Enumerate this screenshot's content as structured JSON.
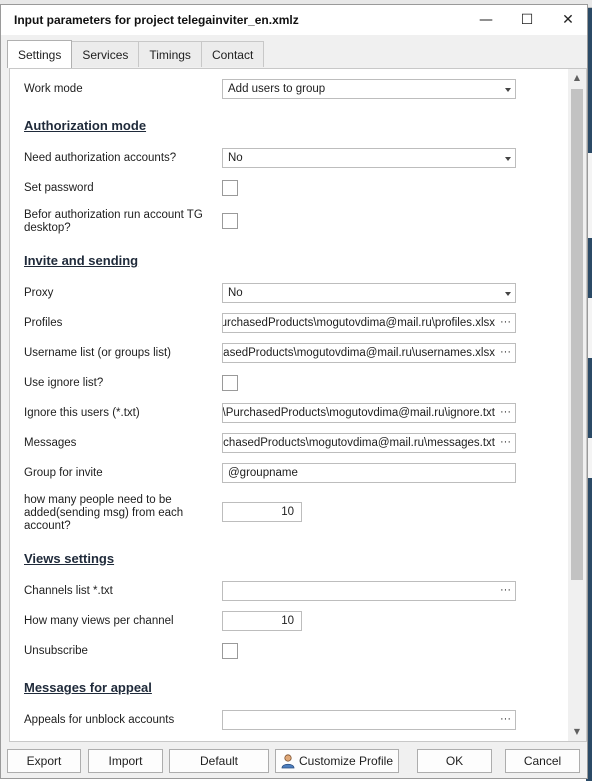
{
  "window": {
    "title": "Input parameters for project telegainviter_en.xmlz",
    "minimize_glyph": "—",
    "maximize_glyph": "☐",
    "close_glyph": "✕"
  },
  "tabs": [
    {
      "label": "Settings",
      "active": true
    },
    {
      "label": "Services",
      "active": false
    },
    {
      "label": "Timings",
      "active": false
    },
    {
      "label": "Contact",
      "active": false
    }
  ],
  "settings": {
    "work_mode": {
      "label": "Work mode",
      "value": "Add users to group"
    },
    "sections": {
      "authorization": "Authorization mode",
      "invite": "Invite and sending",
      "views": "Views settings",
      "appeal": "Messages for appeal"
    },
    "need_auth": {
      "label": "Need authorization accounts?",
      "value": "No"
    },
    "set_password": {
      "label": "Set password",
      "checked": false
    },
    "run_tg_desktop": {
      "label": "Befor authorization run account TG desktop?",
      "checked": false
    },
    "proxy": {
      "label": "Proxy",
      "value": "No"
    },
    "profiles": {
      "label": "Profiles",
      "value": "\\PurchasedProducts\\mogutovdima@mail.ru\\profiles.xlsx"
    },
    "username_list": {
      "label": "Username list (or groups list)",
      "value": "chasedProducts\\mogutovdima@mail.ru\\usernames.xlsx"
    },
    "use_ignore": {
      "label": "Use ignore list?",
      "checked": false
    },
    "ignore_users": {
      "label": "Ignore this users (*.txt)",
      "value": "x\\PurchasedProducts\\mogutovdima@mail.ru\\ignore.txt"
    },
    "messages": {
      "label": "Messages",
      "value": "urchasedProducts\\mogutovdima@mail.ru\\messages.txt"
    },
    "group_invite": {
      "label": "Group for invite",
      "value": "@groupname"
    },
    "people_per_account": {
      "label": "how many people need to be added(sending msg) from each account?",
      "value": "10"
    },
    "channels_list": {
      "label": "Channels list *.txt",
      "value": ""
    },
    "views_per_channel": {
      "label": "How many views per channel",
      "value": "10"
    },
    "unsubscribe": {
      "label": "Unsubscribe",
      "checked": false
    },
    "appeals": {
      "label": "Appeals for unblock accounts",
      "value": ""
    },
    "browse_glyph": "···"
  },
  "scrollbar": {
    "up_glyph": "▲",
    "down_glyph": "▼"
  },
  "buttons": {
    "export": "Export",
    "import": "Import",
    "default": "Default",
    "customize": "Customize Profile",
    "ok": "OK",
    "cancel": "Cancel"
  }
}
